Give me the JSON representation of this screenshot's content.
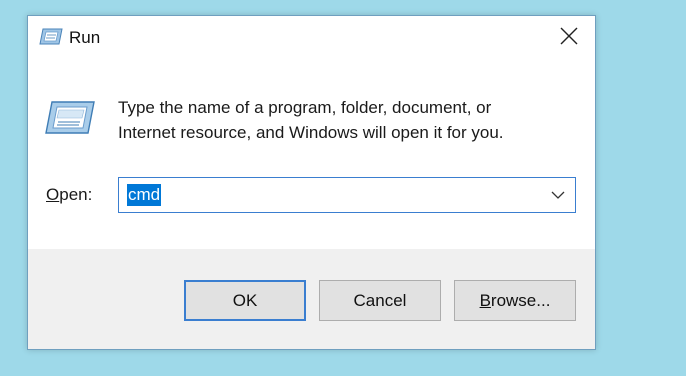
{
  "window": {
    "title": "Run",
    "close_label": "Close"
  },
  "icons": {
    "title_icon": "run-icon",
    "big_icon": "run-icon",
    "close_icon": "close-icon",
    "dropdown_icon": "chevron-down-icon"
  },
  "body": {
    "description_line1": "Type the name of a program, folder, document, or",
    "description_line2": "Internet resource, and Windows will open it for you.",
    "open_label_access": "O",
    "open_label_rest": "pen:"
  },
  "input": {
    "value": "cmd",
    "selected": true
  },
  "buttons": {
    "ok": "OK",
    "cancel": "Cancel",
    "browse_access": "B",
    "browse_rest": "rowse..."
  },
  "colors": {
    "desktop": "#9ed9e9",
    "accent": "#0078d7",
    "footer": "#f0f0f0"
  }
}
